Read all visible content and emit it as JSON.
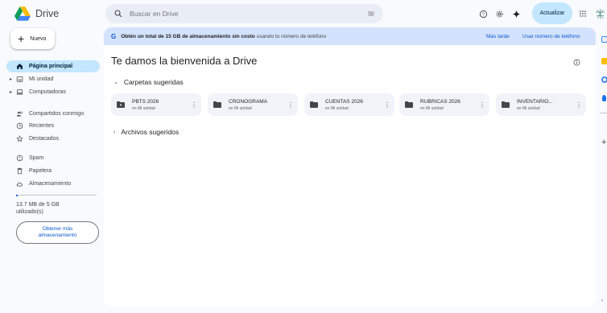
{
  "app": {
    "name": "Drive",
    "colors": {
      "accent": "#0b57d0",
      "active_bg": "#c2e7ff",
      "banner_bg": "#d3e3fd"
    }
  },
  "header": {
    "search_placeholder": "Buscar en Drive",
    "upgrade_label": "Actualizar",
    "icons": [
      "help-icon",
      "settings-icon",
      "gemini-icon",
      "apps-icon",
      "account-logo-icon"
    ]
  },
  "sidebar": {
    "new_label": "Nuevo",
    "items": [
      {
        "label": "Página principal",
        "icon": "home-icon",
        "active": true,
        "caret": ""
      },
      {
        "label": "Mi unidad",
        "icon": "my-drive-icon",
        "active": false,
        "caret": "▸"
      },
      {
        "label": "Computadoras",
        "icon": "computer-icon",
        "active": false,
        "caret": "▸"
      },
      {
        "label": "Compartidos conmigo",
        "icon": "shared-icon",
        "active": false,
        "caret": ""
      },
      {
        "label": "Recientes",
        "icon": "clock-icon",
        "active": false,
        "caret": ""
      },
      {
        "label": "Destacados",
        "icon": "star-icon",
        "active": false,
        "caret": ""
      },
      {
        "label": "Spam",
        "icon": "spam-icon",
        "active": false,
        "caret": ""
      },
      {
        "label": "Papelera",
        "icon": "trash-icon",
        "active": false,
        "caret": ""
      },
      {
        "label": "Almacenamiento",
        "icon": "cloud-icon",
        "active": false,
        "caret": ""
      }
    ],
    "storage_text": "13.7 MB de 5 GB utilizado(s)",
    "storage_fraction": 0.0027,
    "get_storage_label": "Obtener más almacenamiento"
  },
  "banner": {
    "g": "G",
    "bold_text": "Obtén un total de 15 GB de almacenamiento sin costo",
    "rest_text": "usando tu número de teléfono",
    "later_label": "Más tarde",
    "use_phone_label": "Usar número de teléfono"
  },
  "main": {
    "welcome": "Te damos la bienvenida a Drive",
    "suggested_folders_label": "Carpetas sugeridas",
    "suggested_files_label": "Archivos sugeridos",
    "folders": [
      {
        "name": "PBTS 2026",
        "location": "en Mi unidad"
      },
      {
        "name": "CRONOGRAMA",
        "location": "en Mi unidad"
      },
      {
        "name": "CUENTAS 2026",
        "location": "en Mi unidad"
      },
      {
        "name": "RUBRICAS 2026",
        "location": "en Mi unidad"
      },
      {
        "name": "INVENTARIO...",
        "location": "en Mi unidad"
      }
    ]
  }
}
